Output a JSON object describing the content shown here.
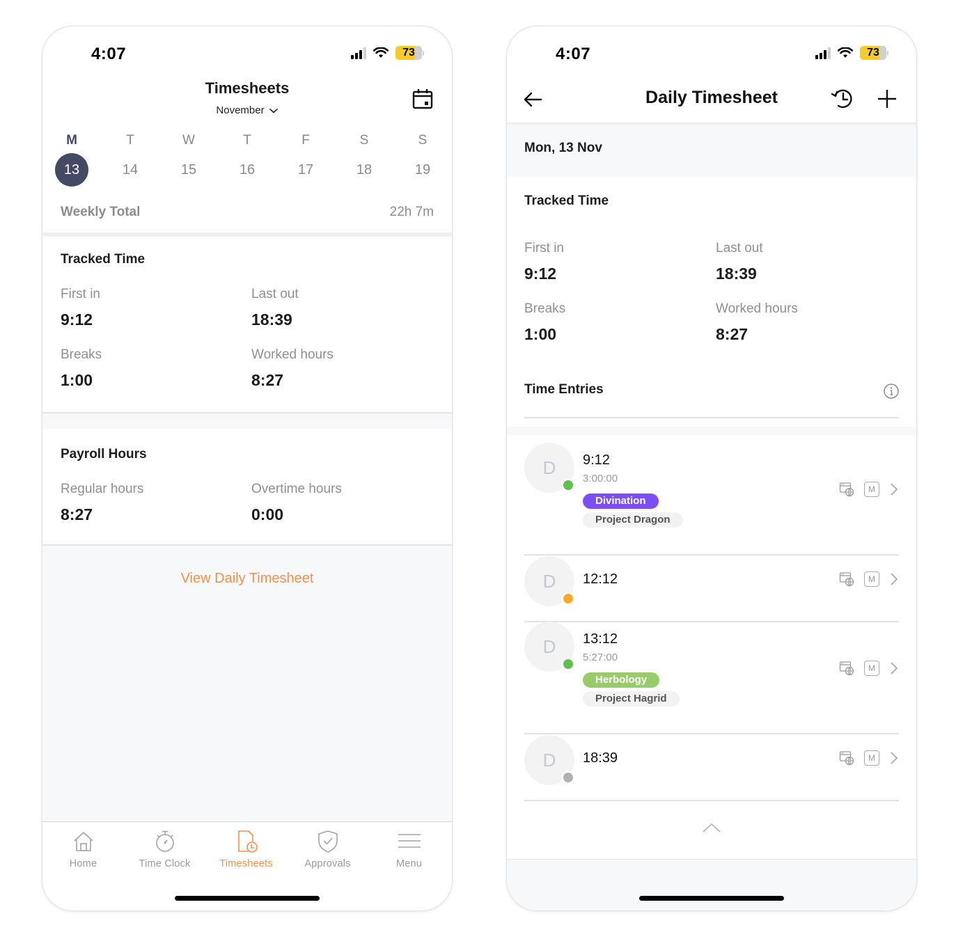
{
  "status_bar": {
    "time": "4:07",
    "battery": "73",
    "battery_level": 0.73
  },
  "left": {
    "title": "Timesheets",
    "month": "November",
    "week": [
      {
        "letter": "M",
        "num": "13",
        "active": true
      },
      {
        "letter": "T",
        "num": "14"
      },
      {
        "letter": "W",
        "num": "15"
      },
      {
        "letter": "T",
        "num": "16"
      },
      {
        "letter": "F",
        "num": "17"
      },
      {
        "letter": "S",
        "num": "18"
      },
      {
        "letter": "S",
        "num": "19"
      }
    ],
    "weekly_total_label": "Weekly Total",
    "weekly_total_value": "22h 7m",
    "tracked": {
      "title": "Tracked Time",
      "first_in_label": "First in",
      "first_in": "9:12",
      "last_out_label": "Last out",
      "last_out": "18:39",
      "breaks_label": "Breaks",
      "breaks": "1:00",
      "worked_label": "Worked hours",
      "worked": "8:27"
    },
    "payroll": {
      "title": "Payroll Hours",
      "regular_label": "Regular hours",
      "regular": "8:27",
      "overtime_label": "Overtime hours",
      "overtime": "0:00"
    },
    "view_daily_link": "View Daily Timesheet",
    "tabs": [
      {
        "label": "Home",
        "icon": "home-icon"
      },
      {
        "label": "Time Clock",
        "icon": "stopwatch-icon"
      },
      {
        "label": "Timesheets",
        "icon": "timesheet-icon",
        "active": true
      },
      {
        "label": "Approvals",
        "icon": "shield-check-icon"
      },
      {
        "label": "Menu",
        "icon": "hamburger-icon"
      }
    ]
  },
  "right": {
    "title": "Daily Timesheet",
    "date": "Mon, 13 Nov",
    "tracked": {
      "title": "Tracked Time",
      "first_in_label": "First in",
      "first_in": "9:12",
      "last_out_label": "Last out",
      "last_out": "18:39",
      "breaks_label": "Breaks",
      "breaks": "1:00",
      "worked_label": "Worked hours",
      "worked": "8:27"
    },
    "entries_title": "Time Entries",
    "entries": [
      {
        "initial": "D",
        "time": "9:12",
        "duration": "3:00:00",
        "task": "Divination",
        "task_color": "#7b4ff5",
        "project": "Project Dragon",
        "status_color": "#5fbf4f"
      },
      {
        "initial": "D",
        "time": "12:12",
        "status_color": "#f8ab2a"
      },
      {
        "initial": "D",
        "time": "13:12",
        "duration": "5:27:00",
        "task": "Herbology",
        "task_color": "#98cc6a",
        "project": "Project Hagrid",
        "status_color": "#5fbf4f"
      },
      {
        "initial": "D",
        "time": "18:39",
        "status_color": "#b1b1b1"
      }
    ],
    "manual_badge": "M"
  }
}
